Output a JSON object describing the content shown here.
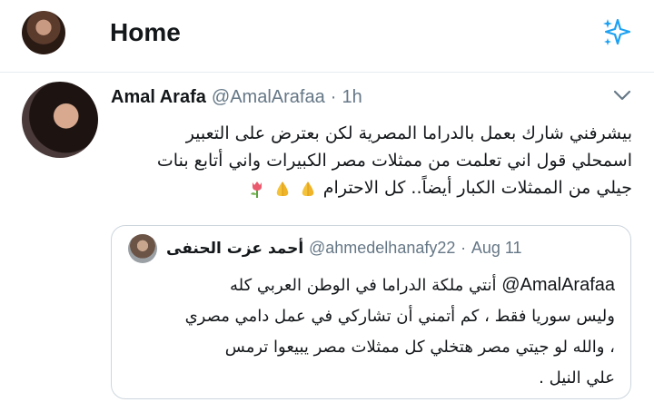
{
  "header": {
    "title": "Home",
    "accent_color": "#1da1f2",
    "sparkle_icon": "sparkle-icon"
  },
  "tweet": {
    "name": "Amal Arafa",
    "handle": "@AmalArafaa",
    "separator": "·",
    "time": "1h",
    "lines": [
      "بيشرفني شارك بعمل بالدراما المصرية لكن بعترض على التعبير",
      "اسمحلي قول اني تعلمت من ممثلات مصر الكبيرات واني أتابع بنات",
      "جيلي من الممثلات الكبار أيضاً.. كل الاحترام"
    ],
    "emojis": [
      "folded-hands",
      "folded-hands",
      "tulip"
    ]
  },
  "quoted_tweet": {
    "name": "أحمد عزت الحنفى",
    "handle": "@ahmedelhanafy22",
    "separator": "·",
    "date": "Aug 11",
    "mention": "@AmalArafaa",
    "lines": [
      "أنتي ملكة الدراما في الوطن العربي كله",
      "وليس سوريا فقط ، كم أتمني أن تشاركي في عمل دامي مصري",
      "، والله لو جيتي مصر هتخلي كل ممثلات مصر يبيعوا ترمس",
      "علي النيل ."
    ]
  },
  "colors": {
    "text": "#14171a",
    "secondary": "#657786",
    "border": "#ccd6dd",
    "divider": "#e6ecf0"
  }
}
